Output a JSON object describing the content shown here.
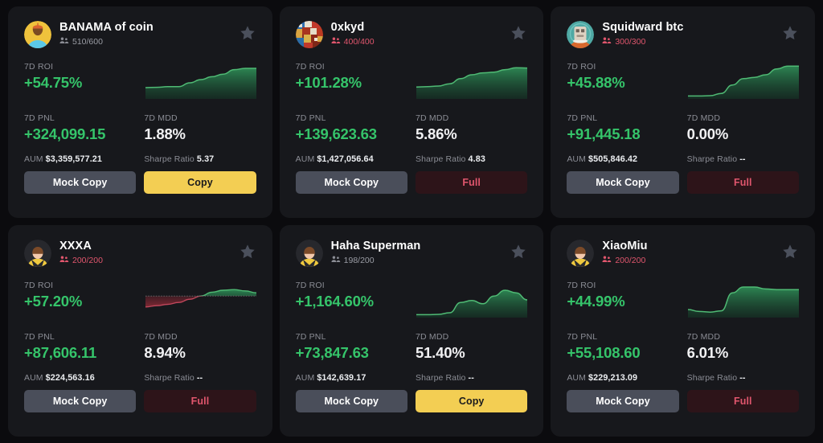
{
  "theme": {
    "page_bg": "#0b0b0e",
    "card_bg": "#17181c",
    "positive": "#35c46a",
    "negative": "#e0566d",
    "accent_copy": "#f3ce53",
    "muted_text": "#8b8d95",
    "star_color": "#4b505c"
  },
  "labels": {
    "roi": "7D ROI",
    "pnl": "7D PNL",
    "mdd": "7D MDD",
    "aum": "AUM",
    "sharpe": "Sharpe Ratio",
    "mock_copy": "Mock Copy",
    "copy": "Copy",
    "full": "Full",
    "star_icon": "star-icon",
    "people_icon": "people-icon"
  },
  "cards": [
    {
      "name": "BANAMA of coin",
      "members": "510/600",
      "members_full": false,
      "avatar": "acorn-yellow",
      "roi": "+54.75%",
      "pnl": "+324,099.15",
      "mdd": "1.88%",
      "aum": "$3,359,577.21",
      "sharpe": "5.37",
      "action": "Copy",
      "action_kind": "copy",
      "favorited": false,
      "chart": {
        "type": "area",
        "trend": "positive",
        "series": [
          0.3,
          0.31,
          0.33,
          0.33,
          0.45,
          0.55,
          0.64,
          0.72,
          0.86,
          0.9,
          0.9
        ]
      }
    },
    {
      "name": "0xkyd",
      "members": "400/400",
      "members_full": true,
      "avatar": "mosaic",
      "roi": "+101.28%",
      "pnl": "+139,623.63",
      "mdd": "5.86%",
      "aum": "$1,427,056.64",
      "sharpe": "4.83",
      "action": "Full",
      "action_kind": "full",
      "favorited": false,
      "chart": {
        "type": "area",
        "trend": "positive",
        "series": [
          0.32,
          0.33,
          0.35,
          0.42,
          0.58,
          0.7,
          0.76,
          0.78,
          0.86,
          0.92,
          0.91
        ]
      }
    },
    {
      "name": "Squidward btc",
      "members": "300/300",
      "members_full": true,
      "avatar": "astronaut-teal",
      "roi": "+45.88%",
      "pnl": "+91,445.18",
      "mdd": "0.00%",
      "aum": "$505,846.42",
      "sharpe": "--",
      "action": "Full",
      "action_kind": "full",
      "favorited": false,
      "chart": {
        "type": "area",
        "trend": "positive",
        "series": [
          0.04,
          0.04,
          0.05,
          0.12,
          0.38,
          0.58,
          0.62,
          0.7,
          0.88,
          0.97,
          0.97
        ]
      }
    },
    {
      "name": "XXXA",
      "members": "200/200",
      "members_full": true,
      "avatar": "default",
      "roi": "+57.20%",
      "pnl": "+87,606.11",
      "mdd": "8.94%",
      "aum": "$224,563.16",
      "sharpe": "--",
      "action": "Full",
      "action_kind": "full",
      "favorited": false,
      "chart": {
        "type": "area-diverging",
        "trend": "mixed",
        "baseline": 0.62,
        "series": [
          0.28,
          0.32,
          0.36,
          0.42,
          0.52,
          0.62,
          0.74,
          0.8,
          0.82,
          0.78,
          0.72
        ]
      }
    },
    {
      "name": "Haha Superman",
      "members": "198/200",
      "members_full": false,
      "avatar": "default",
      "roi": "+1,164.60%",
      "pnl": "+73,847.63",
      "mdd": "51.40%",
      "aum": "$142,639.17",
      "sharpe": "--",
      "action": "Copy",
      "action_kind": "copy",
      "favorited": false,
      "chart": {
        "type": "area",
        "trend": "positive",
        "series": [
          0.04,
          0.04,
          0.05,
          0.1,
          0.42,
          0.48,
          0.38,
          0.62,
          0.8,
          0.72,
          0.5
        ]
      }
    },
    {
      "name": "XiaoMiu",
      "members": "200/200",
      "members_full": true,
      "avatar": "default",
      "roi": "+44.99%",
      "pnl": "+55,108.60",
      "mdd": "6.01%",
      "aum": "$229,213.09",
      "sharpe": "--",
      "action": "Full",
      "action_kind": "full",
      "favorited": false,
      "chart": {
        "type": "area",
        "trend": "positive",
        "series": [
          0.2,
          0.14,
          0.12,
          0.16,
          0.72,
          0.9,
          0.9,
          0.84,
          0.82,
          0.82,
          0.82
        ]
      }
    }
  ]
}
